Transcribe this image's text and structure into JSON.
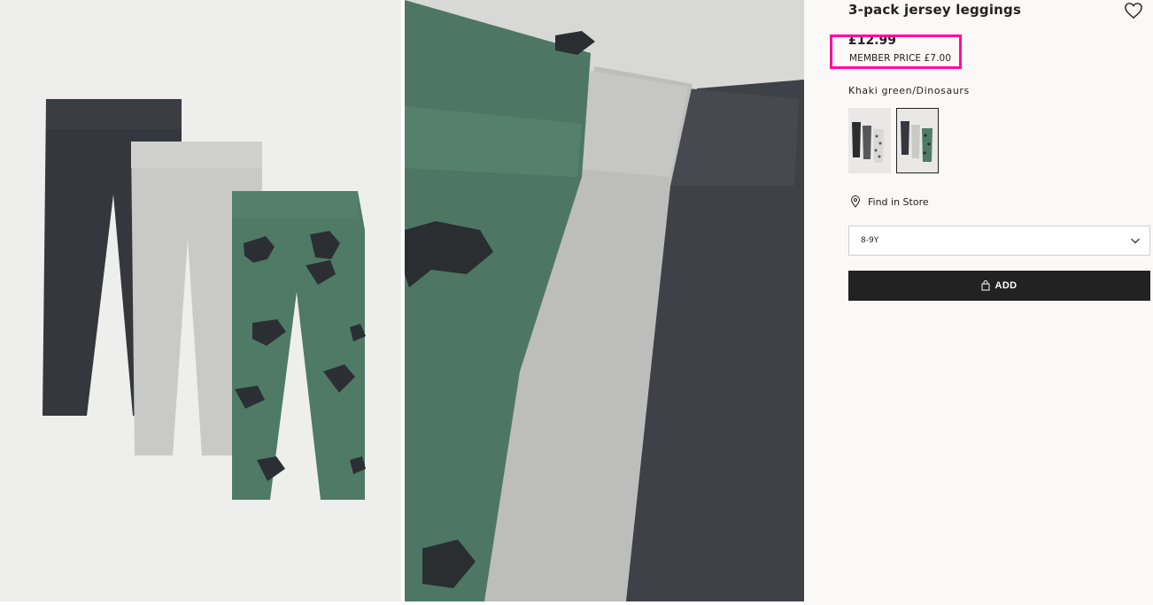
{
  "product": {
    "title": "3-pack jersey leggings",
    "price": "£12.99",
    "member_price": "MEMBER PRICE £7.00",
    "color_label": "Khaki green/Dinosaurs"
  },
  "store": {
    "find_label": "Find in Store"
  },
  "size": {
    "selected": "8-9Y"
  },
  "actions": {
    "add_label": "ADD"
  },
  "icons": [
    "heart-icon",
    "location-pin-icon",
    "chevron-down-icon",
    "shopping-bag-icon"
  ],
  "colors": {
    "highlight": "#ff0da0",
    "button": "#222222",
    "green": "#4e7a66",
    "grey": "#cfcfcd",
    "charcoal": "#3c3f45"
  }
}
